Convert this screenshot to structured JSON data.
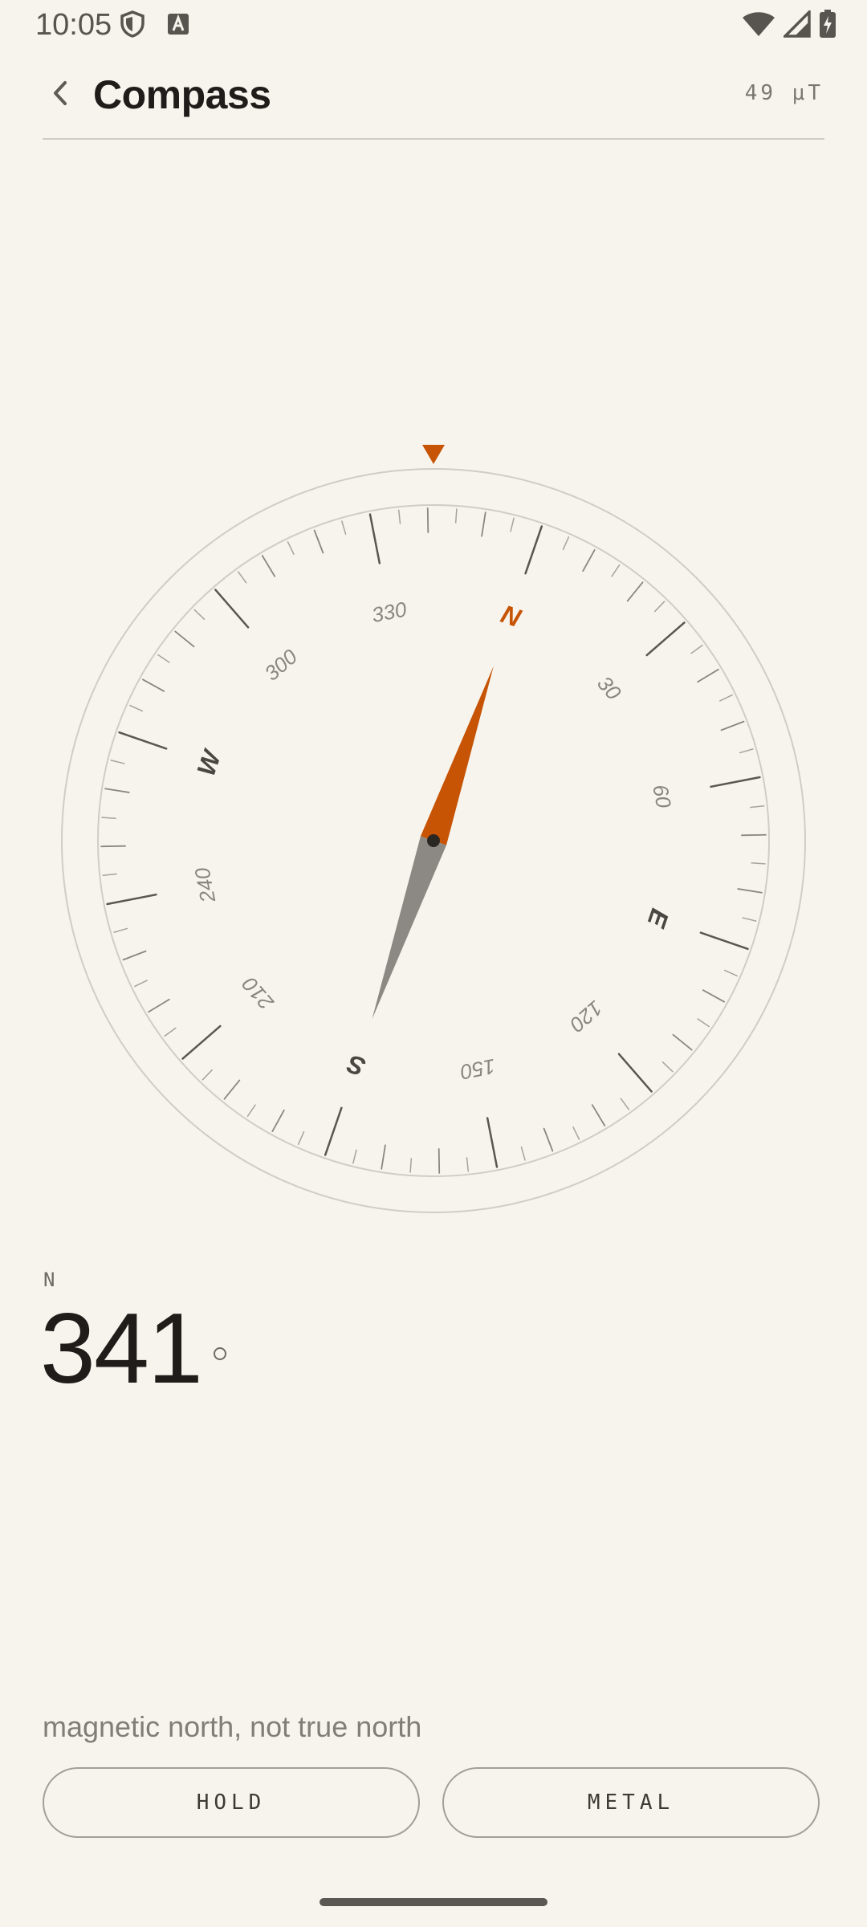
{
  "status_bar": {
    "time": "10:05",
    "left_icons": [
      "shield-icon",
      "font-a-icon"
    ],
    "right_icons": [
      "wifi-icon",
      "cellular-signal-icon",
      "battery-charging-icon"
    ]
  },
  "header": {
    "title": "Compass",
    "field_strength": "49 μT"
  },
  "compass": {
    "heading_deg": 341,
    "cardinals": [
      {
        "label": "N",
        "deg": 0,
        "color": "#c65404"
      },
      {
        "label": "E",
        "deg": 90,
        "color": "#4a4642"
      },
      {
        "label": "S",
        "deg": 180,
        "color": "#4a4642"
      },
      {
        "label": "W",
        "deg": 270,
        "color": "#4a4642"
      }
    ],
    "degree_labels": [
      "30",
      "60",
      "120",
      "150",
      "210",
      "240",
      "300",
      "330"
    ],
    "accent_color": "#c65404",
    "tail_color": "#8c8883"
  },
  "reading": {
    "direction": "N",
    "value": "341"
  },
  "footer": {
    "note": "magnetic north, not true north",
    "hold_label": "HOLD",
    "metal_label": "METAL"
  }
}
